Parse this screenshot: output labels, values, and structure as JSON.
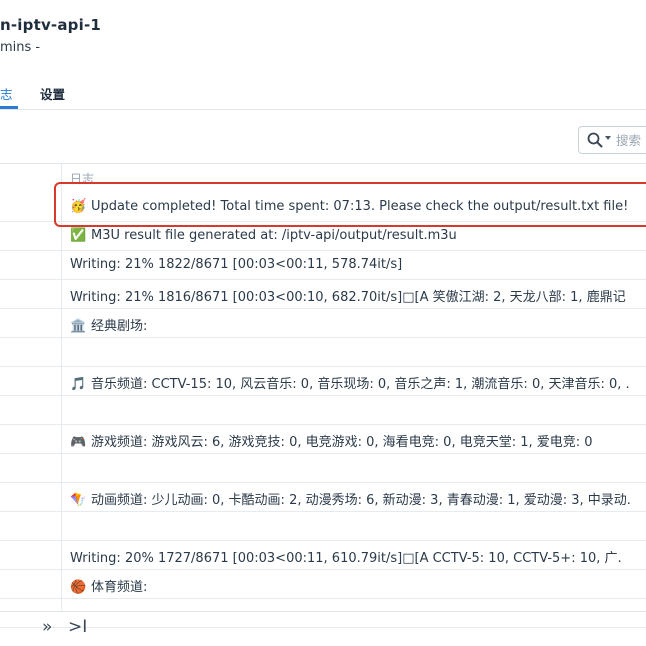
{
  "header": {
    "title": "n-iptv-api-1",
    "subtitle": " mins -"
  },
  "tabs": [
    {
      "label": "志"
    },
    {
      "label": "设置"
    }
  ],
  "search": {
    "placeholder": "搜索",
    "icon": "search-icon"
  },
  "table": {
    "column_header": "日志",
    "rows": [
      {
        "icon": "🥳",
        "text": "Update completed! Total time spent: 07:13. Please check the output/result.txt file!"
      },
      {
        "icon": "✅",
        "text": "M3U result file generated at: /iptv-api/output/result.m3u"
      },
      {
        "icon": "",
        "text": "Writing: 21% 1822/8671 [00:03<00:11, 578.74it/s]"
      },
      {
        "icon": "",
        "text": "Writing: 21% 1816/8671 [00:03<00:10, 682.70it/s]□[A 笑傲江湖: 2, 天龙八部: 1, 鹿鼎记"
      },
      {
        "icon": "🏛️",
        "text": "经典剧场:"
      },
      {
        "icon": "",
        "text": ""
      },
      {
        "icon": "🎵",
        "text": "音乐频道: CCTV-15: 10, 风云音乐: 0, 音乐现场: 0, 音乐之声: 1, 潮流音乐: 0, 天津音乐: 0, ."
      },
      {
        "icon": "",
        "text": ""
      },
      {
        "icon": "🎮",
        "text": "游戏频道: 游戏风云: 6, 游戏竞技: 0, 电竞游戏: 0, 海看电竞: 0, 电竞天堂: 1, 爱电竞: 0"
      },
      {
        "icon": "",
        "text": ""
      },
      {
        "icon": "🪁",
        "text": "动画频道: 少儿动画: 0, 卡酷动画: 2, 动漫秀场: 6, 新动漫: 3, 青春动漫: 1, 爱动漫: 3, 中录动."
      },
      {
        "icon": "",
        "text": ""
      },
      {
        "icon": "",
        "text": "Writing: 20% 1727/8671 [00:03<00:11, 610.79it/s]□[A CCTV-5: 10, CCTV-5+: 10, 广."
      },
      {
        "icon": "🏀",
        "text": "体育频道:"
      },
      {
        "icon": "",
        "text": ""
      }
    ]
  },
  "pagination": {
    "next": "»",
    "last": ">I"
  },
  "colors": {
    "accent": "#2a79d6",
    "highlight_border": "#d9392b"
  }
}
